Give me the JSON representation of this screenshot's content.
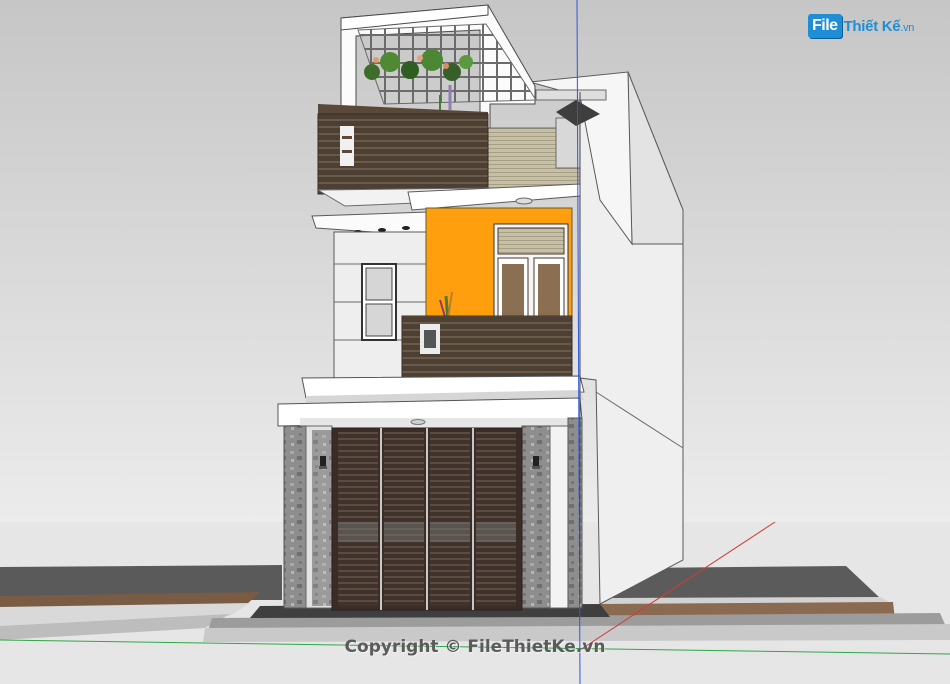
{
  "watermark": {
    "logo_file": "File",
    "logo_name": "Thiết Kế",
    "logo_domain": ".vn",
    "copyright": "Copyright © FileThietKe.vn"
  },
  "colors": {
    "sky_top": "#c9c9c9",
    "sky_bottom": "#ececec",
    "ground": "#e4e4e4",
    "facade_white": "#fafafa",
    "side_wall": "#eeeeee",
    "orange_wall": "#ff9f0e",
    "wood_dark": "#5a4a3a",
    "door_brown": "#4b3a32",
    "stone_gray": "#8c8c8c",
    "axis_blue": "#2b55e6",
    "axis_red": "#d23b3b",
    "axis_green": "#2fa84a",
    "brand_blue": "#1e8fd6"
  }
}
